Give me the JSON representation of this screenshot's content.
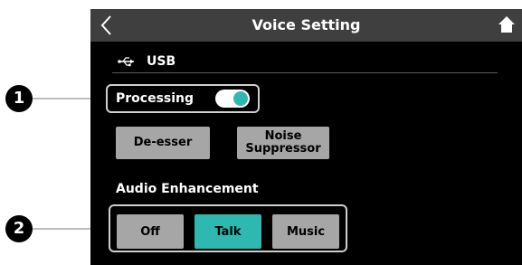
{
  "header": {
    "title": "Voice Setting",
    "back_icon": "chevron-left-icon",
    "home_icon": "home-icon"
  },
  "source": {
    "icon": "usb-icon",
    "label": "USB"
  },
  "processing": {
    "label": "Processing",
    "enabled": true
  },
  "effects": {
    "deesser_label": "De-esser",
    "noise_label_line1": "Noise",
    "noise_label_line2": "Suppressor"
  },
  "audio_enhancement": {
    "label": "Audio Enhancement",
    "options": [
      "Off",
      "Talk",
      "Music"
    ],
    "selected": "Talk"
  },
  "callouts": {
    "marker1": "1",
    "marker2": "2"
  },
  "colors": {
    "accent": "#2fb8b0",
    "button_gray": "#a6a6a6",
    "header_bg": "#3f3f3f",
    "screen_bg": "#000000"
  }
}
